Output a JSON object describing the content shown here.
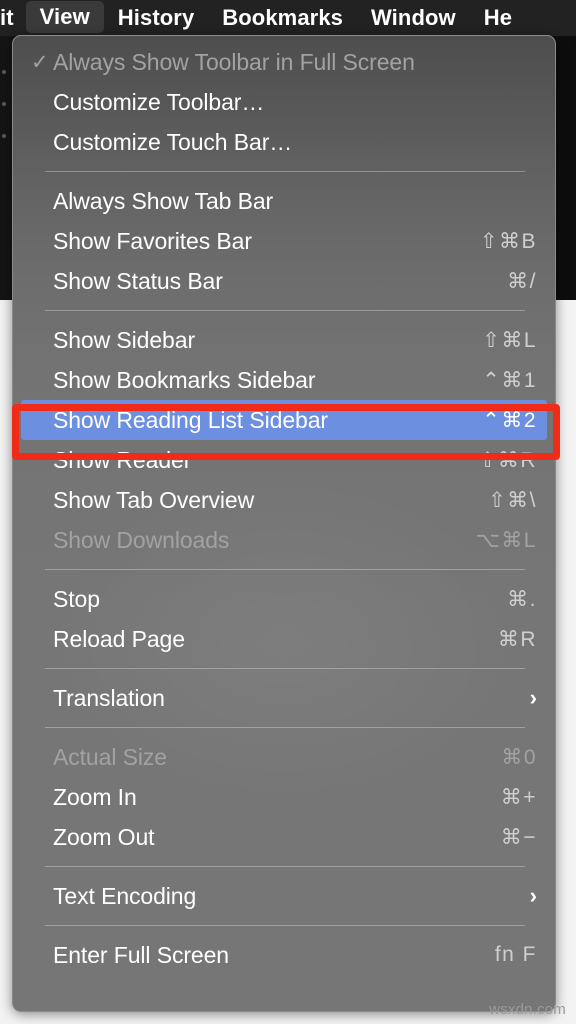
{
  "menubar": {
    "items": [
      {
        "label": "it",
        "active": false,
        "truncated": true
      },
      {
        "label": "View",
        "active": true,
        "truncated": false
      },
      {
        "label": "History",
        "active": false,
        "truncated": false
      },
      {
        "label": "Bookmarks",
        "active": false,
        "truncated": false
      },
      {
        "label": "Window",
        "active": false,
        "truncated": false
      },
      {
        "label": "He",
        "active": false,
        "truncated": false
      }
    ]
  },
  "menu": {
    "title": "View",
    "groups": [
      {
        "items": [
          {
            "label": "Always Show Toolbar in Full Screen",
            "shortcut": "",
            "checked": true,
            "disabled": true,
            "selected": false,
            "submenu": false
          },
          {
            "label": "Customize Toolbar…",
            "shortcut": "",
            "checked": false,
            "disabled": false,
            "selected": false,
            "submenu": false
          },
          {
            "label": "Customize Touch Bar…",
            "shortcut": "",
            "checked": false,
            "disabled": false,
            "selected": false,
            "submenu": false
          }
        ]
      },
      {
        "items": [
          {
            "label": "Always Show Tab Bar",
            "shortcut": "",
            "checked": false,
            "disabled": false,
            "selected": false,
            "submenu": false
          },
          {
            "label": "Show Favorites Bar",
            "shortcut": "⇧⌘B",
            "checked": false,
            "disabled": false,
            "selected": false,
            "submenu": false
          },
          {
            "label": "Show Status Bar",
            "shortcut": "⌘/",
            "checked": false,
            "disabled": false,
            "selected": false,
            "submenu": false
          }
        ]
      },
      {
        "items": [
          {
            "label": "Show Sidebar",
            "shortcut": "⇧⌘L",
            "checked": false,
            "disabled": false,
            "selected": false,
            "submenu": false
          },
          {
            "label": "Show Bookmarks Sidebar",
            "shortcut": "⌃⌘1",
            "checked": false,
            "disabled": false,
            "selected": false,
            "submenu": false
          },
          {
            "label": "Show Reading List Sidebar",
            "shortcut": "⌃⌘2",
            "checked": false,
            "disabled": false,
            "selected": true,
            "submenu": false
          },
          {
            "label": "Show Reader",
            "shortcut": "⇧⌘R",
            "checked": false,
            "disabled": false,
            "selected": false,
            "submenu": false
          },
          {
            "label": "Show Tab Overview",
            "shortcut": "⇧⌘\\",
            "checked": false,
            "disabled": false,
            "selected": false,
            "submenu": false
          },
          {
            "label": "Show Downloads",
            "shortcut": "⌥⌘L",
            "checked": false,
            "disabled": true,
            "selected": false,
            "submenu": false
          }
        ]
      },
      {
        "items": [
          {
            "label": "Stop",
            "shortcut": "⌘.",
            "checked": false,
            "disabled": false,
            "selected": false,
            "submenu": false
          },
          {
            "label": "Reload Page",
            "shortcut": "⌘R",
            "checked": false,
            "disabled": false,
            "selected": false,
            "submenu": false
          }
        ]
      },
      {
        "items": [
          {
            "label": "Translation",
            "shortcut": "",
            "checked": false,
            "disabled": false,
            "selected": false,
            "submenu": true
          }
        ]
      },
      {
        "items": [
          {
            "label": "Actual Size",
            "shortcut": "⌘0",
            "checked": false,
            "disabled": true,
            "selected": false,
            "submenu": false
          },
          {
            "label": "Zoom In",
            "shortcut": "⌘+",
            "checked": false,
            "disabled": false,
            "selected": false,
            "submenu": false
          },
          {
            "label": "Zoom Out",
            "shortcut": "⌘−",
            "checked": false,
            "disabled": false,
            "selected": false,
            "submenu": false
          }
        ]
      },
      {
        "items": [
          {
            "label": "Text Encoding",
            "shortcut": "",
            "checked": false,
            "disabled": false,
            "selected": false,
            "submenu": true
          }
        ]
      },
      {
        "items": [
          {
            "label": "Enter Full Screen",
            "shortcut": "fn F",
            "checked": false,
            "disabled": false,
            "selected": false,
            "submenu": false
          }
        ]
      }
    ],
    "checkmark_glyph": "✓",
    "submenu_glyph": "›"
  },
  "annotation": {
    "target_label": "Show Reading List Sidebar",
    "color": "#f02b17"
  },
  "watermark": {
    "text": "wsxdn.com"
  },
  "colors": {
    "menubar_background": "#222222",
    "menu_background": "#767676",
    "selection_blue": "#6d8fe0",
    "annotation_red": "#f02b17",
    "text": "#ffffff",
    "text_disabled": "#a2a2a2"
  }
}
